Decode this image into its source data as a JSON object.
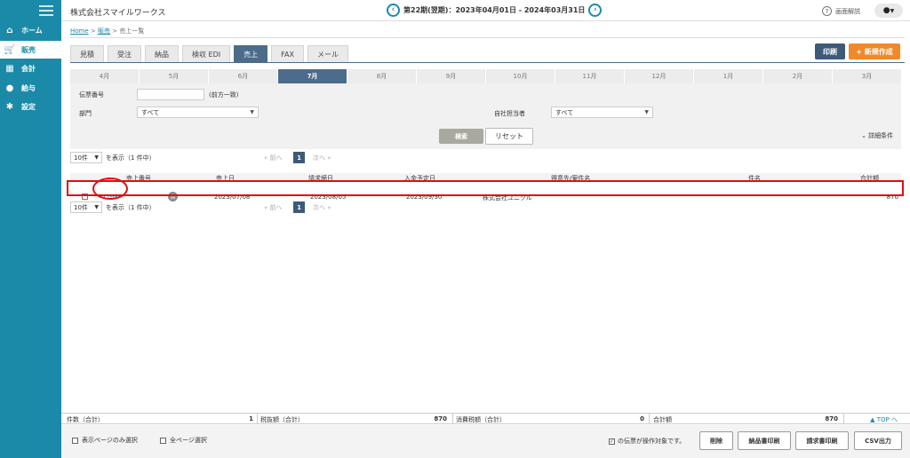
{
  "sidebar": {
    "items": [
      {
        "label": "ホーム",
        "icon": "home-icon"
      },
      {
        "label": "販売",
        "icon": "cart-icon"
      },
      {
        "label": "会計",
        "icon": "calculator-icon"
      },
      {
        "label": "給与",
        "icon": "money-bag-icon"
      },
      {
        "label": "設定",
        "icon": "gear-icon"
      }
    ]
  },
  "header": {
    "company": "株式会社スマイルワークス",
    "period": "第22期(翌期)：2023年04月01日 - 2024年03月31日",
    "help": "画面解説"
  },
  "breadcrumb": {
    "home": "Home",
    "sales": "販売",
    "current": "売上一覧",
    "sep": ">"
  },
  "tabs": [
    "見積",
    "受注",
    "納品",
    "検収 EDI",
    "売上",
    "FAX",
    "メール"
  ],
  "active_tab": "売上",
  "actions": {
    "print": "印刷",
    "new": "+ 新規作成"
  },
  "months": [
    "4月",
    "5月",
    "6月",
    "7月",
    "8月",
    "9月",
    "10月",
    "11月",
    "12月",
    "1月",
    "2月",
    "3月"
  ],
  "active_month": "7月",
  "filter": {
    "slip_no_label": "伝票番号",
    "slip_no_note": "(前方一致)",
    "dept_label": "部門",
    "dept_value": "すべて",
    "staff_label": "自社担当者",
    "staff_value": "すべて",
    "search": "検索",
    "reset": "リセット",
    "detail": "詳細条件"
  },
  "pager": {
    "per_page": "10件",
    "show": "を表示（1 件中）",
    "prev": "«  前へ",
    "page": "1",
    "next": "次へ  »"
  },
  "table": {
    "headers": [
      "売上番号",
      "売上日",
      "請求締日",
      "入金予定日",
      "得意先/案件名",
      "件名",
      "合計額"
    ],
    "row": {
      "id": "7168",
      "badge": "済",
      "sales_date": "2023/07/08",
      "billing_date": "2023/08/05",
      "payment_date": "2023/09/30",
      "customer": "株式会社ユニクル",
      "subject": "",
      "total": "870"
    }
  },
  "totals": {
    "count_label": "件数（合計）",
    "count": "1",
    "pretax_label": "税抜額（合計）",
    "pretax": "870",
    "tax_label": "消費税額（合計）",
    "tax": "0",
    "total_label": "合計額",
    "total": "870",
    "to_top": "▲ TOP へ"
  },
  "footer": {
    "select_page": "表示ページのみ選択",
    "select_all": "全ページ選択",
    "selected_note": "の伝票が操作対象です。",
    "delete": "削除",
    "delivery_print": "納品書印刷",
    "invoice_print": "請求書印刷",
    "csv": "CSV出力"
  },
  "colors": {
    "sidebar": "#1b8aa8",
    "accent": "#4d6b8a",
    "new_button": "#f0892a",
    "highlight": "#e20d0d"
  }
}
